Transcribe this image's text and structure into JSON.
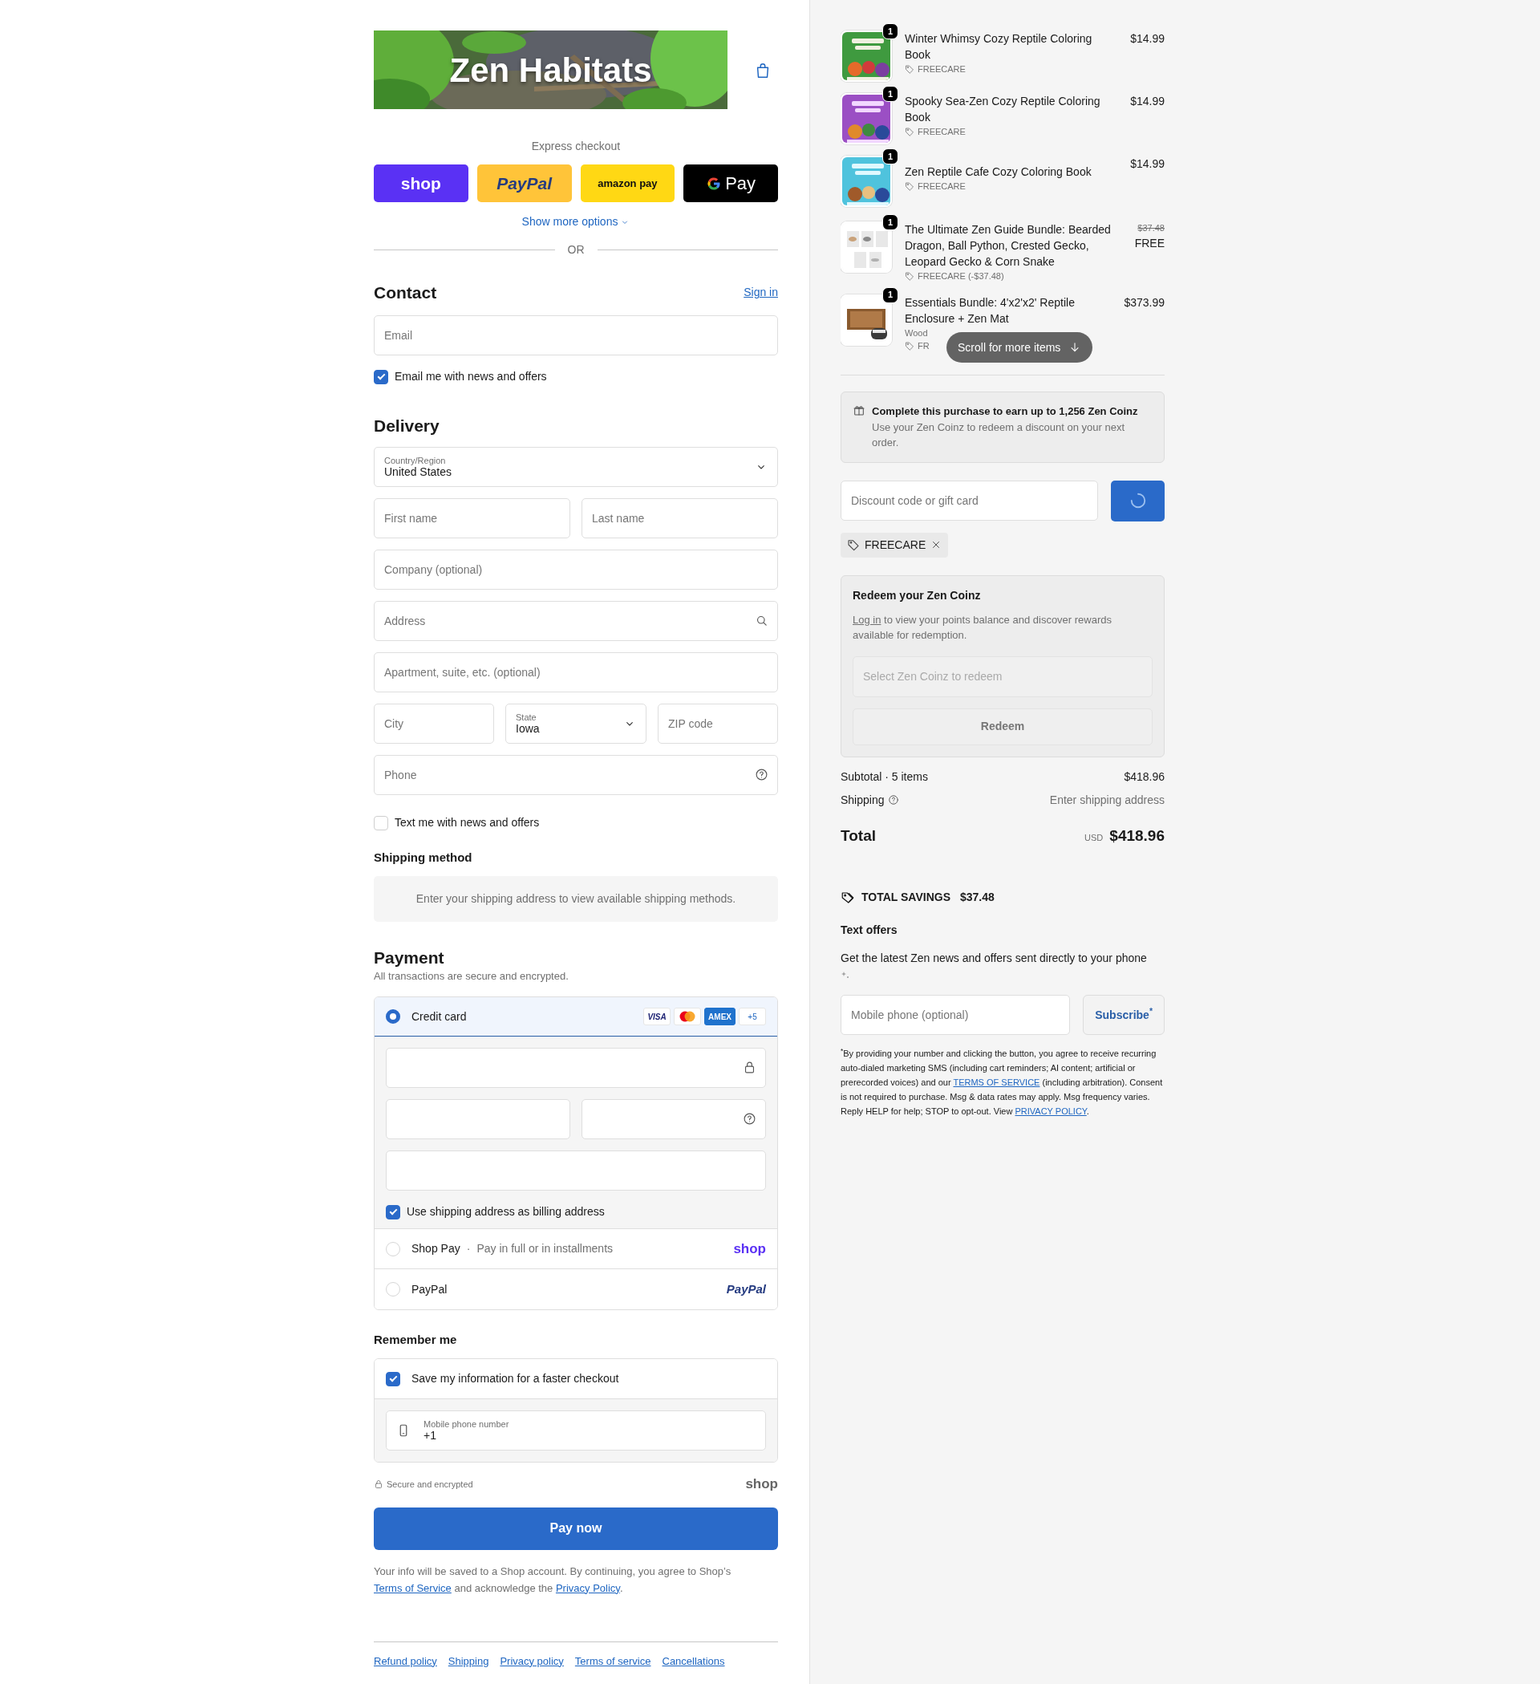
{
  "logo": {
    "text": "Zen Habitats"
  },
  "express_checkout": {
    "label": "Express checkout",
    "buttons": [
      {
        "kind": "shop",
        "label": "shop"
      },
      {
        "kind": "paypal",
        "label": "PayPal"
      },
      {
        "kind": "amazon",
        "label": "amazon pay"
      },
      {
        "kind": "gpay",
        "label": "Pay"
      }
    ],
    "more": "Show more options",
    "divider": "OR"
  },
  "contact": {
    "title": "Contact",
    "sign_in": "Sign in",
    "email": {
      "placeholder": "Email"
    },
    "newsletter": {
      "label": "Email me with news and offers",
      "checked": true
    }
  },
  "delivery": {
    "title": "Delivery",
    "rows": [
      {
        "fields": [
          {
            "kind": "select",
            "label": "Country/Region",
            "value": "United States"
          }
        ]
      },
      {
        "fields": [
          {
            "kind": "text",
            "placeholder": "First name"
          },
          {
            "kind": "text",
            "placeholder": "Last name"
          }
        ]
      },
      {
        "fields": [
          {
            "kind": "text",
            "placeholder": "Company (optional)"
          }
        ]
      },
      {
        "fields": [
          {
            "kind": "search",
            "placeholder": "Address"
          }
        ]
      },
      {
        "fields": [
          {
            "kind": "text",
            "placeholder": "Apartment, suite, etc. (optional)"
          }
        ]
      },
      {
        "fields": [
          {
            "kind": "text",
            "placeholder": "City"
          },
          {
            "kind": "select",
            "label": "State",
            "value": "Iowa"
          },
          {
            "kind": "text",
            "placeholder": "ZIP code"
          }
        ]
      },
      {
        "fields": [
          {
            "kind": "help",
            "placeholder": "Phone"
          }
        ]
      }
    ]
  },
  "sms_opt_in": {
    "label": "Text me with news and offers",
    "checked": false
  },
  "shipping_method": {
    "title": "Shipping method",
    "notice": "Enter your shipping address to view available shipping methods."
  },
  "payment": {
    "title": "Payment",
    "subtitle": "All transactions are secure and encrypted.",
    "methods": [
      {
        "kind": "card",
        "label": "Credit card",
        "selected": true,
        "brands": [
          {
            "kind": "visa",
            "label": "VISA"
          },
          {
            "kind": "mastercard"
          },
          {
            "kind": "amex",
            "label": "AMEX"
          },
          {
            "kind": "more",
            "label": "+5"
          }
        ],
        "card_rows": [
          {
            "fields": [
              {
                "kind": "lock"
              }
            ]
          },
          {
            "fields": [
              {
                "kind": "plain"
              },
              {
                "kind": "help"
              }
            ]
          },
          {
            "fields": [
              {
                "kind": "plain"
              }
            ]
          }
        ],
        "billing": {
          "label": "Use shipping address as billing address",
          "checked": true
        }
      },
      {
        "kind": "shoppay",
        "label": "Shop Pay",
        "separator": "·",
        "note": "Pay in full or in installments",
        "logo": "shop",
        "selected": false
      },
      {
        "kind": "paypal",
        "label": "PayPal",
        "logo": "PayPal",
        "selected": false
      }
    ]
  },
  "remember_me": {
    "title": "Remember me",
    "save": {
      "label": "Save my information for a faster checkout",
      "checked": true
    },
    "phone": {
      "label": "Mobile phone number",
      "value": "+1"
    }
  },
  "secure_note": {
    "text": "Secure and encrypted",
    "logo": "shop"
  },
  "pay_button": "Pay now",
  "legal": [
    {
      "kind": "text",
      "text": "Your info will be saved to a Shop account. By continuing, you agree to Shop’s "
    },
    {
      "kind": "link",
      "text": "Terms of Service"
    },
    {
      "kind": "text",
      "text": " and acknowledge the "
    },
    {
      "kind": "link",
      "text": "Privacy Policy"
    },
    {
      "kind": "text",
      "text": "."
    }
  ],
  "footer_links": [
    "Refund policy",
    "Shipping",
    "Privacy policy",
    "Terms of service",
    "Cancellations"
  ],
  "order_items": [
    {
      "title": "Winter Whimsy Cozy Reptile Coloring Book",
      "quantity": "1",
      "price": "$14.99",
      "discount": "FREECARE"
    },
    {
      "title": "Spooky Sea-Zen Cozy Reptile Coloring Book",
      "quantity": "1",
      "price": "$14.99",
      "discount": "FREECARE"
    },
    {
      "title": "Zen Reptile Cafe Cozy Coloring Book",
      "quantity": "1",
      "price": "$14.99",
      "discount": "FREECARE"
    },
    {
      "title": "The Ultimate Zen Guide Bundle: Bearded Dragon, Ball Python, Crested Gecko, Leopard Gecko & Corn Snake",
      "quantity": "1",
      "original_price": "$37.48",
      "price": "FREE",
      "discount": "FREECARE (-$37.48)"
    },
    {
      "title": "Essentials Bundle: 4'x2'x2' Reptile Enclosure + Zen Mat",
      "quantity": "1",
      "price": "$373.99",
      "variant": "Wood",
      "discount": "FR"
    }
  ],
  "scroll_hint": "Scroll for more items",
  "rewards_banner": {
    "title": "Complete this purchase to earn up to 1,256 Zen Coinz",
    "text": "Use your Zen Coinz to redeem a discount on your next order."
  },
  "discount": {
    "placeholder": "Discount code or gift card",
    "loading": true
  },
  "applied_codes": [
    "FREECARE"
  ],
  "redeem": {
    "title": "Redeem your Zen Coinz",
    "login": "Log in",
    "text": " to view your points balance and discover rewards available for redemption.",
    "select": {
      "placeholder": "Select Zen Coinz to redeem"
    },
    "button": "Redeem"
  },
  "summary": {
    "subtotal_label": "Subtotal · 5 items",
    "subtotal": "$418.96",
    "shipping_label": "Shipping",
    "shipping": "Enter shipping address",
    "total_label": "Total",
    "currency": "USD",
    "total": "$418.96"
  },
  "savings": {
    "label": "TOTAL SAVINGS",
    "amount": "$37.48"
  },
  "text_offers": {
    "title": "Text offers",
    "text": "Get the latest Zen news and offers sent directly to your phone",
    "phone": {
      "placeholder": "Mobile phone (optional)"
    },
    "button": "Subscribe$^{*}$",
    "disclaimer": [
      {
        "kind": "text",
        "text": "$^{*}$By providing your number and clicking the button, you agree to receive recurring auto-dialed marketing SMS (including cart reminders; AI content; artificial or prerecorded voices) and our "
      },
      {
        "kind": "link",
        "text": "TERMS OF SERVICE"
      },
      {
        "kind": "text",
        "text": " (including arbitration). Consent is not required to purchase. Msg & data rates may apply. Msg frequency varies. Reply HELP for help; STOP to opt-out. View "
      },
      {
        "kind": "link",
        "text": "PRIVACY POLICY"
      },
      {
        "kind": "text",
        "text": "."
      }
    ]
  }
}
